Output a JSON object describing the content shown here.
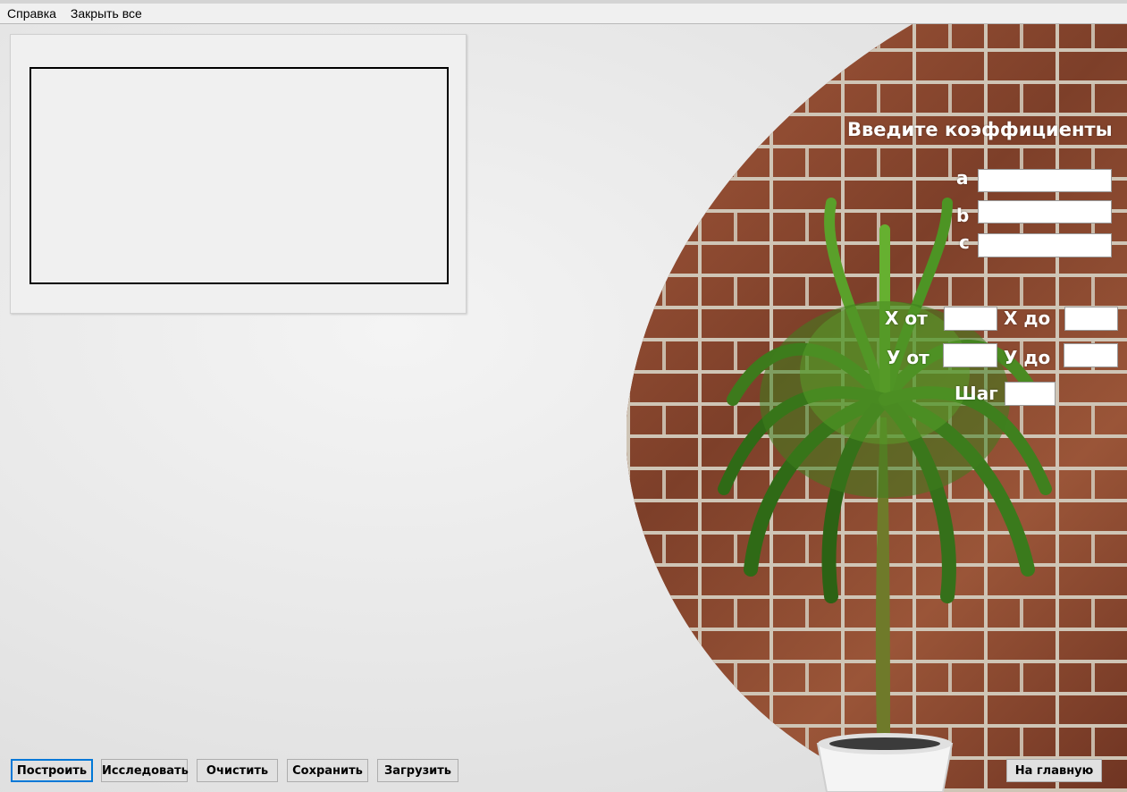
{
  "menu": {
    "items": [
      "Справка",
      "Закрыть все"
    ]
  },
  "form": {
    "title": "Введите коэффициенты",
    "coefficients": [
      {
        "label": "a",
        "value": ""
      },
      {
        "label": "b",
        "value": ""
      },
      {
        "label": "c",
        "value": ""
      }
    ],
    "range": {
      "x_from_label": "X от",
      "x_from": "",
      "x_to_label": "X до",
      "x_to": "",
      "y_from_label": "У от",
      "y_from": "",
      "y_to_label": "У до",
      "y_to": "",
      "step_label": "Шаг",
      "step": ""
    }
  },
  "buttons": {
    "build": "Построить",
    "investigate": "Исследовать",
    "clear": "Очистить",
    "save": "Сохранить",
    "load": "Загрузить",
    "home": "На главную"
  },
  "colors": {
    "focus_border": "#0078d7",
    "brick": "#8a4a32",
    "label_text": "#ffffff"
  }
}
